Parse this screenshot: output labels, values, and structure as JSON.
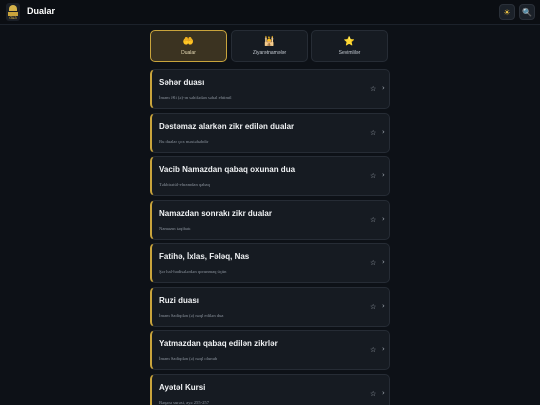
{
  "app": {
    "title": "Dualar",
    "logo_text": "dua"
  },
  "header": {
    "theme_icon": "sun-icon",
    "search_icon": "search-icon"
  },
  "tabs": [
    {
      "label": "Dualar",
      "icon": "praying-hands-icon",
      "glyph": "🤲",
      "active": true
    },
    {
      "label": "Ziyarətnamələr",
      "icon": "mosque-icon",
      "glyph": "🕌",
      "active": false
    },
    {
      "label": "Sevimlilər",
      "icon": "star-icon",
      "glyph": "⭐",
      "active": false
    }
  ],
  "items": [
    {
      "title": "Səhər duası",
      "subtitle": "İmam Əli (ə)-ın səhifədən səhəl ehtimtl"
    },
    {
      "title": "Dəstəmaz alarkən zikr edilən dualar",
      "subtitle": "Bu dualar çox məstəhəbdir"
    },
    {
      "title": "Vacib Namazdan qabaq oxunan dua",
      "subtitle": "Təkbirətül-ehramdan qabaq"
    },
    {
      "title": "Namazdan sonrakı zikr dualar",
      "subtitle": "Namazın təqibatı"
    },
    {
      "title": "Fatihə, İxlas, Fələq, Nas",
      "subtitle": "Şər hal-hadisələrdən qorunmaq üçün"
    },
    {
      "title": "Ruzi duası",
      "subtitle": "İmam Sadiqdən (ə) nəql edilən dua"
    },
    {
      "title": "Yatmazdan qabaq edilən zikrlər",
      "subtitle": "İmam Sadiqdən (ə) nəql olunub"
    },
    {
      "title": "Ayətəl Kursi",
      "subtitle": "Bəqərə surəsi, ayə 255-257"
    }
  ],
  "colors": {
    "accent": "#c9a43c",
    "background": "#0d1117",
    "card": "#161b22"
  }
}
